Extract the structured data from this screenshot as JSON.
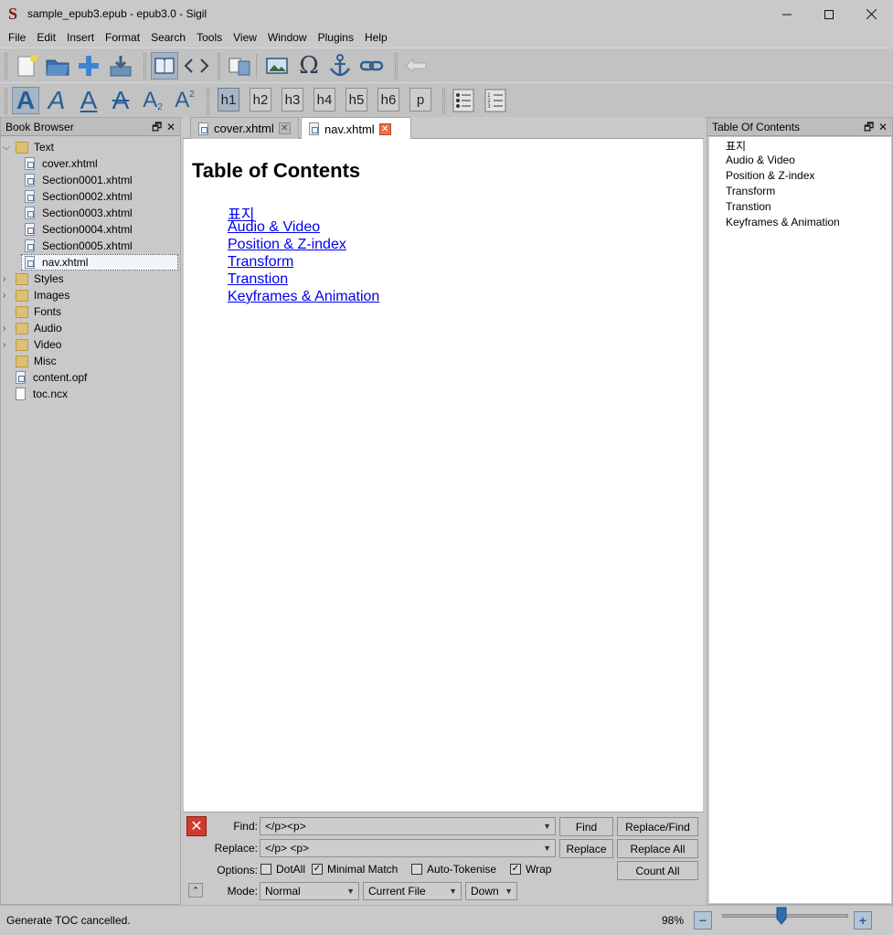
{
  "window": {
    "title": "sample_epub3.epub - epub3.0 - Sigil",
    "app_icon": "S"
  },
  "menu": [
    "File",
    "Edit",
    "Insert",
    "Format",
    "Search",
    "Tools",
    "View",
    "Window",
    "Plugins",
    "Help"
  ],
  "toolbar2": {
    "headings": [
      "h1",
      "h2",
      "h3",
      "h4",
      "h5",
      "h6",
      "p"
    ],
    "active_heading": "h1"
  },
  "book_browser": {
    "title": "Book Browser",
    "items": [
      {
        "label": "Text",
        "kind": "folder",
        "expanded": true
      },
      {
        "label": "cover.xhtml",
        "kind": "xhtml"
      },
      {
        "label": "Section0001.xhtml",
        "kind": "xhtml"
      },
      {
        "label": "Section0002.xhtml",
        "kind": "xhtml"
      },
      {
        "label": "Section0003.xhtml",
        "kind": "xhtml"
      },
      {
        "label": "Section0004.xhtml",
        "kind": "xhtml"
      },
      {
        "label": "Section0005.xhtml",
        "kind": "xhtml"
      },
      {
        "label": "nav.xhtml",
        "kind": "xhtml",
        "selected": true
      },
      {
        "label": "Styles",
        "kind": "folder"
      },
      {
        "label": "Images",
        "kind": "folder"
      },
      {
        "label": "Fonts",
        "kind": "folder"
      },
      {
        "label": "Audio",
        "kind": "folder"
      },
      {
        "label": "Video",
        "kind": "folder"
      },
      {
        "label": "Misc",
        "kind": "folder"
      },
      {
        "label": "content.opf",
        "kind": "file"
      },
      {
        "label": "toc.ncx",
        "kind": "file"
      }
    ]
  },
  "tabs": [
    {
      "label": "cover.xhtml",
      "active": false
    },
    {
      "label": "nav.xhtml",
      "active": true
    }
  ],
  "document": {
    "heading": "Table of Contents",
    "links": [
      "표지",
      "Audio & Video",
      "Position & Z-index",
      "Transform",
      "Transtion",
      "Keyframes & Animation"
    ]
  },
  "find_replace": {
    "find_label": "Find:",
    "find_value": "</p><p>",
    "replace_label": "Replace:",
    "replace_value": "</p> <p>",
    "options_label": "Options:",
    "mode_label": "Mode:",
    "mode_value": "Normal",
    "scope_value": "Current File",
    "direction_value": "Down",
    "buttons": {
      "find": "Find",
      "replace_find": "Replace/Find",
      "replace": "Replace",
      "replace_all": "Replace All",
      "count_all": "Count All"
    },
    "options": [
      {
        "label": "DotAll",
        "checked": false
      },
      {
        "label": "Minimal Match",
        "checked": true
      },
      {
        "label": "Auto-Tokenise",
        "checked": false
      },
      {
        "label": "Wrap",
        "checked": true
      }
    ]
  },
  "toc_panel": {
    "title": "Table Of Contents",
    "items": [
      "표지",
      "Audio & Video",
      "Position & Z-index",
      "Transform",
      "Transtion",
      "Keyframes & Animation"
    ]
  },
  "status": {
    "message": "Generate TOC cancelled.",
    "zoom": "98%"
  }
}
